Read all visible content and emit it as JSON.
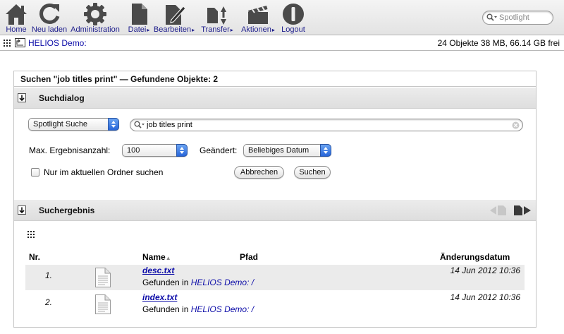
{
  "toolbar": {
    "items": [
      {
        "label": "Home",
        "icon": "home-icon",
        "menu": false
      },
      {
        "label": "Neu laden",
        "icon": "reload-icon",
        "menu": false
      },
      {
        "label": "Administration",
        "icon": "gear-icon",
        "menu": false
      },
      {
        "label": "Datei",
        "icon": "file-icon",
        "menu": true
      },
      {
        "label": "Bearbeiten",
        "icon": "edit-icon",
        "menu": true
      },
      {
        "label": "Transfer",
        "icon": "transfer-icon",
        "menu": true
      },
      {
        "label": "Aktionen",
        "icon": "clapper-icon",
        "menu": true
      },
      {
        "label": "Logout",
        "icon": "logout-icon",
        "menu": false
      }
    ],
    "menu_arrow": "▸",
    "spotlight_placeholder": "Spotlight"
  },
  "pathbar": {
    "location": "HELIOS Demo:",
    "stats": "24 Objekte 38 MB, 66.14 GB frei"
  },
  "search": {
    "title": "Suchen \"job titles print\"  — Gefundene Objekte: 2",
    "dialog_label": "Suchdialog",
    "search_type": "Spotlight Suche",
    "query": "job titles print",
    "max_results_label": "Max. Ergebnisanzahl:",
    "max_results_value": "100",
    "changed_label": "Geändert:",
    "changed_value": "Beliebiges Datum",
    "current_folder_label": "Nur im aktuellen Ordner suchen",
    "cancel_label": "Abbrechen",
    "search_label": "Suchen"
  },
  "results": {
    "section_label": "Suchergebnis",
    "columns": {
      "nr": "Nr.",
      "name": "Name",
      "sort_indicator": "▲",
      "path": "Pfad",
      "date": "Änderungsdatum"
    },
    "rows": [
      {
        "nr": "1.",
        "name": "desc.txt",
        "found_prefix": "Gefunden in",
        "path": "HELIOS Demo: /",
        "date": "14 Jun 2012 10:36"
      },
      {
        "nr": "2.",
        "name": "index.txt",
        "found_prefix": "Gefunden in",
        "path": "HELIOS Demo: /",
        "date": "14 Jun 2012 10:36"
      }
    ]
  },
  "colors": {
    "link": "#0c0ca8",
    "icon": "#4a4a4a",
    "select_accent": "#2765d9"
  }
}
